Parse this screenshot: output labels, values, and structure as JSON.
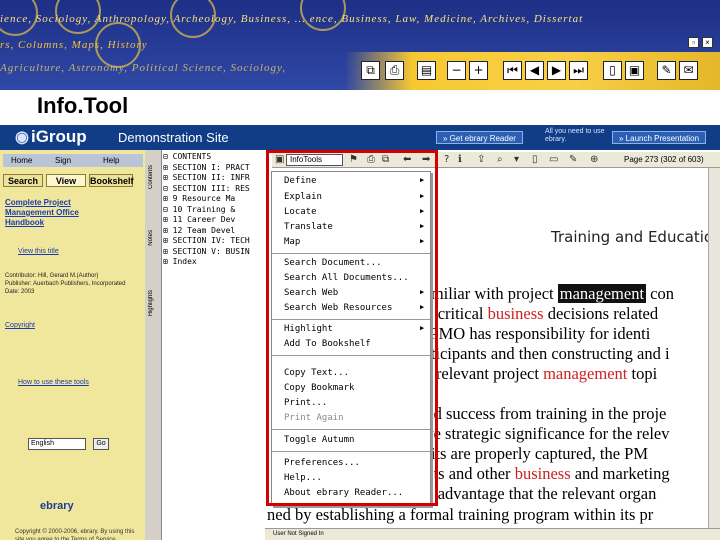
{
  "banner": {
    "ticker_top": "ience, Sociology, Anthropology, Archeology, Business, ... ence, Business, Law, Medicine, Archives, Dissertat",
    "ticker_mid": "rs, Columns, Maps, History",
    "ticker_bottom": "Agriculture, Astronomy, Political Science, Sociology,",
    "colors": {
      "bg": "#1d2f86",
      "gold": "#f7c832",
      "text": "#ffd23c"
    }
  },
  "info": {
    "title": "Info.Tool"
  },
  "igroup": {
    "logo": "iGroup",
    "site": "Demonstration Site",
    "get_reader": "» Get ebrary Reader",
    "hint": "All you need to use ebrary.",
    "launch": "» Launch Presentation"
  },
  "left": {
    "nav": [
      "Home",
      "Sign",
      "Help"
    ],
    "tabs": [
      "Search",
      "View",
      "Bookshelf"
    ],
    "book_title": "Complete Project Management Office Handbook",
    "view_link": "View this title",
    "meta": [
      "Contributor: Hill, Gerard M.(Author)",
      "Publisher: Auerbach Publishers, Incorporated",
      "Date: 2003"
    ],
    "copy_link": "Copyright",
    "how_link": "How to use these tools",
    "language": "English",
    "go": "Go",
    "brand": "ebrary",
    "footer": "Copyright © 2000-2006, ebrary. By using this site you agree to the Terms of Service"
  },
  "vtabs": [
    "Contents",
    "Notes",
    "Highlights"
  ],
  "toc": [
    "⊟ CONTENTS",
    "⊞ SECTION I: PRACT",
    "⊞ SECTION II: INFR",
    "⊟ SECTION III: RES",
    "  ⊞ 9 Resource Ma",
    "  ⊟ 10 Training &",
    "  ⊞ 11 Career Dev",
    "  ⊞ 12 Team Devel",
    "⊞ SECTION IV: TECH",
    "⊞ SECTION V: BUSIN",
    "⊞ Index"
  ],
  "reader_toolbar": {
    "menu_label": "InfoTools",
    "page": "Page 273 (302 of 603)"
  },
  "doc": {
    "heading": "Training and Educatio",
    "lines": [
      {
        "pre": "familiar with project ",
        "hl": "management",
        "post": " con"
      },
      {
        "pre": "ke critical ",
        "red": "business",
        "post": " decisions related"
      },
      {
        "pre": "e PMO has responsibility for identi"
      },
      {
        "pre": "articipants and then constructing and i"
      },
      {
        "pre": "of relevant project ",
        "red": "management",
        "post": " topi"
      },
      {
        "pre": "and success from training in the proje"
      },
      {
        "pre": "ave strategic significance for the relev"
      },
      {
        "pre": "efits are properly captured, the PM"
      },
      {
        "pre": "ents and other ",
        "red": "business",
        "post": " and marketing"
      },
      {
        "pre": "ve advantage that the relevant organ"
      },
      {
        "pre": "ned by establishing a formal training program within its pr"
      }
    ]
  },
  "menu": {
    "items": [
      {
        "label": "Define",
        "sub": true
      },
      {
        "label": "Explain",
        "sub": true
      },
      {
        "label": "Locate",
        "sub": true
      },
      {
        "label": "Translate",
        "sub": true
      },
      {
        "label": "Map",
        "sub": true
      },
      {
        "label": "Search Document..."
      },
      {
        "label": "Search All Documents..."
      },
      {
        "label": "Search Web",
        "sub": true
      },
      {
        "label": "Search Web Resources",
        "sub": true
      },
      {
        "label": "Highlight",
        "sub": true
      },
      {
        "label": "Add To Bookshelf"
      },
      {
        "label": "Copy Text..."
      },
      {
        "label": "Copy Bookmark"
      },
      {
        "label": "Print..."
      },
      {
        "label": "Print Again",
        "disabled": true
      },
      {
        "label": "Toggle Autumn"
      },
      {
        "label": "Preferences..."
      },
      {
        "label": "Help..."
      },
      {
        "label": "About ebrary Reader..."
      }
    ]
  },
  "status": "User Not Signed In"
}
